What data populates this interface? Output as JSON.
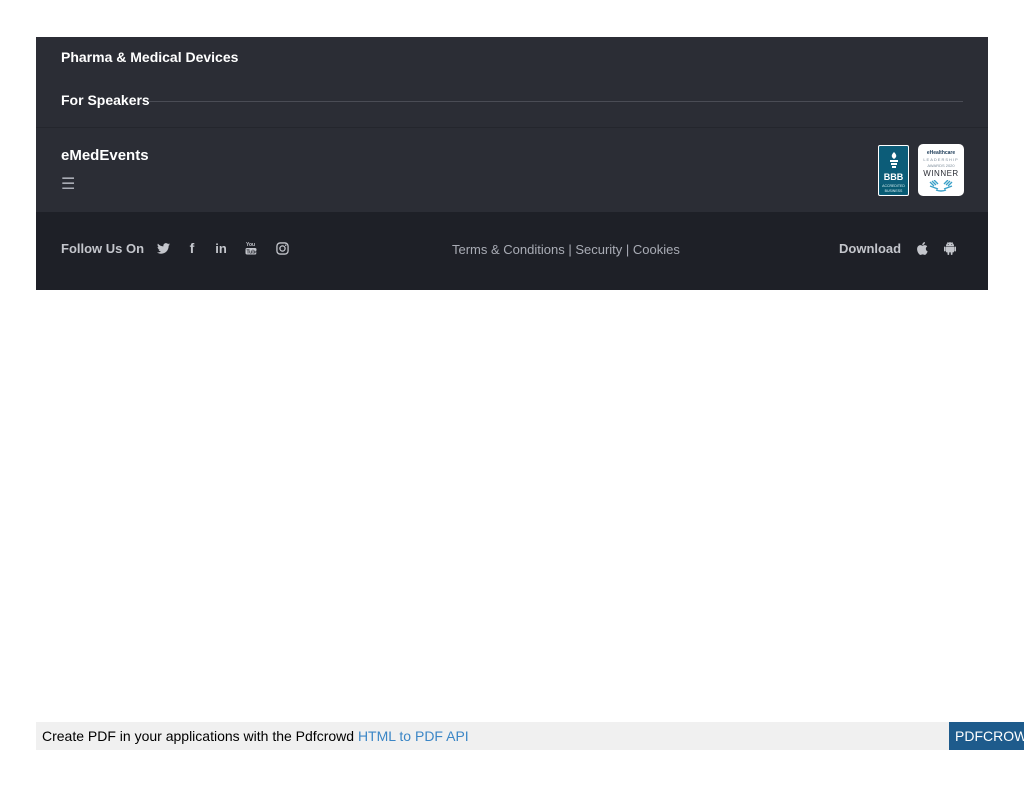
{
  "menu": {
    "pharma_label": "Pharma & Medical Devices",
    "speakers_label": "For Speakers"
  },
  "brand": {
    "title": "eMedEvents",
    "menu_icon": "hamburger-icon"
  },
  "badges": {
    "bbb": {
      "text": "BBB",
      "subtext": "ACCREDITED BUSINESS"
    },
    "award": {
      "line1": "eHealthcare",
      "line2": "LEADERSHIP",
      "line3": "AWARDS 2020",
      "line4": "WINNER"
    }
  },
  "bottom": {
    "follow_label": "Follow Us On",
    "social_icons": [
      "twitter-icon",
      "facebook-icon",
      "linkedin-icon",
      "youtube-icon",
      "instagram-icon"
    ],
    "legal": {
      "terms": "Terms & Conditions",
      "security": "Security",
      "cookies": "Cookies",
      "separator": " | "
    },
    "download_label": "Download",
    "download_icons": [
      "apple-icon",
      "android-icon"
    ]
  },
  "pdfcrowd": {
    "text": "Create PDF in your applications with the Pdfcrowd ",
    "link": "HTML to PDF API",
    "badge": "PDFCROWD"
  },
  "colors": {
    "footer_bg": "#2b2d35",
    "bottom_bar_bg": "#1e2027",
    "bbb_blue": "#0c5c78",
    "link_blue": "#3b86c6"
  }
}
